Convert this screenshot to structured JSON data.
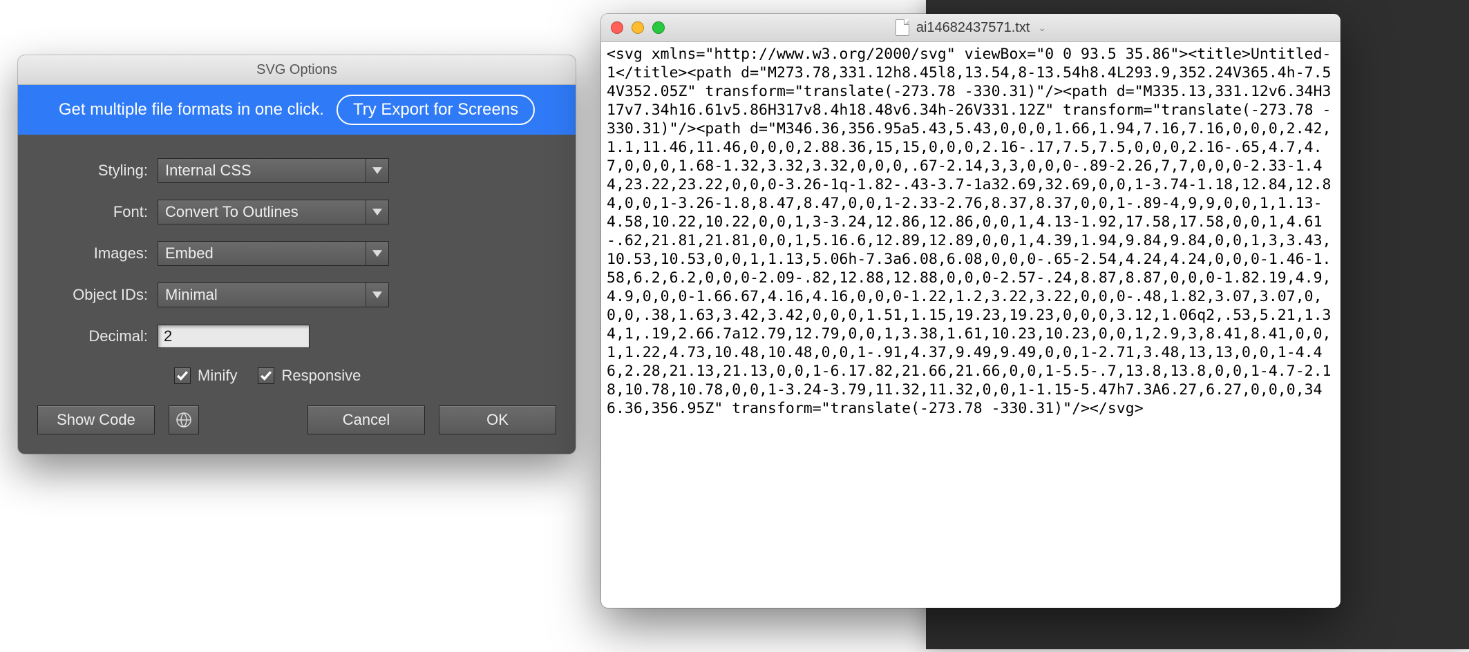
{
  "dialog": {
    "title": "SVG Options",
    "promo_text": "Get multiple file formats in one click.",
    "promo_button": "Try Export for Screens",
    "labels": {
      "styling": "Styling:",
      "font": "Font:",
      "images": "Images:",
      "object_ids": "Object IDs:",
      "decimal": "Decimal:"
    },
    "values": {
      "styling": "Internal CSS",
      "font": "Convert To Outlines",
      "images": "Embed",
      "object_ids": "Minimal",
      "decimal": "2"
    },
    "check": {
      "minify": "Minify",
      "responsive": "Responsive",
      "minify_checked": true,
      "responsive_checked": true
    },
    "buttons": {
      "show_code": "Show Code",
      "cancel": "Cancel",
      "ok": "OK"
    }
  },
  "text_window": {
    "filename": "ai14682437571.txt",
    "content": "<svg xmlns=\"http://www.w3.org/2000/svg\" viewBox=\"0 0 93.5 35.86\"><title>Untitled-1</title><path d=\"M273.78,331.12h8.45l8,13.54,8-13.54h8.4L293.9,352.24V365.4h-7.54V352.05Z\" transform=\"translate(-273.78 -330.31)\"/><path d=\"M335.13,331.12v6.34H317v7.34h16.61v5.86H317v8.4h18.48v6.34h-26V331.12Z\" transform=\"translate(-273.78 -330.31)\"/><path d=\"M346.36,356.95a5.43,5.43,0,0,0,1.66,1.94,7.16,7.16,0,0,0,2.42,1.1,11.46,11.46,0,0,0,2.88.36,15,15,0,0,0,2.16-.17,7.5,7.5,0,0,0,2.16-.65,4.7,4.7,0,0,0,1.68-1.32,3.32,3.32,0,0,0,.67-2.14,3,3,0,0,0-.89-2.26,7,7,0,0,0-2.33-1.44,23.22,23.22,0,0,0-3.26-1q-1.82-.43-3.7-1a32.69,32.69,0,0,1-3.74-1.18,12.84,12.84,0,0,1-3.26-1.8,8.47,8.47,0,0,1-2.33-2.76,8.37,8.37,0,0,1-.89-4,9,9,0,0,1,1.13-4.58,10.22,10.22,0,0,1,3-3.24,12.86,12.86,0,0,1,4.13-1.92,17.58,17.58,0,0,1,4.61-.62,21.81,21.81,0,0,1,5.16.6,12.89,12.89,0,0,1,4.39,1.94,9.84,9.84,0,0,1,3,3.43,10.53,10.53,0,0,1,1.13,5.06h-7.3a6.08,6.08,0,0,0-.65-2.54,4.24,4.24,0,0,0-1.46-1.58,6.2,6.2,0,0,0-2.09-.82,12.88,12.88,0,0,0-2.57-.24,8.87,8.87,0,0,0-1.82.19,4.9,4.9,0,0,0-1.66.67,4.16,4.16,0,0,0-1.22,1.2,3.22,3.22,0,0,0-.48,1.82,3.07,3.07,0,0,0,.38,1.63,3.42,3.42,0,0,0,1.51,1.15,19.23,19.23,0,0,0,3.12,1.06q2,.53,5.21,1.34,1,.19,2.66.7a12.79,12.79,0,0,1,3.38,1.61,10.23,10.23,0,0,1,2.9,3,8.41,8.41,0,0,1,1.22,4.73,10.48,10.48,0,0,1-.91,4.37,9.49,9.49,0,0,1-2.71,3.48,13,13,0,0,1-4.46,2.28,21.13,21.13,0,0,1-6.17.82,21.66,21.66,0,0,1-5.5-.7,13.8,13.8,0,0,1-4.7-2.18,10.78,10.78,0,0,1-3.24-3.79,11.32,11.32,0,0,1-1.15-5.47h7.3A6.27,6.27,0,0,0,346.36,356.95Z\" transform=\"translate(-273.78 -330.31)\"/></svg>"
  }
}
